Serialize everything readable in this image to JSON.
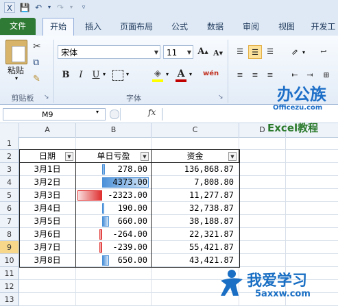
{
  "quick_access": {
    "icons": [
      "save-icon",
      "undo-icon",
      "redo-icon",
      "customize-icon"
    ]
  },
  "tabs": [
    {
      "label": "文件",
      "active": false
    },
    {
      "label": "开始",
      "active": true
    },
    {
      "label": "插入",
      "active": false
    },
    {
      "label": "页面布局",
      "active": false
    },
    {
      "label": "公式",
      "active": false
    },
    {
      "label": "数据",
      "active": false
    },
    {
      "label": "审阅",
      "active": false
    },
    {
      "label": "视图",
      "active": false
    },
    {
      "label": "开发工",
      "active": false
    }
  ],
  "ribbon": {
    "clipboard": {
      "paste_label": "粘贴",
      "group_label": "剪贴板"
    },
    "font": {
      "font_name": "宋体",
      "font_size": "11",
      "group_label": "字体",
      "bold": "B",
      "italic": "I",
      "underline": "U",
      "grow": "A",
      "shrink": "A",
      "fill_color": "#ffff00",
      "font_color": "#c00000",
      "phonetic": "wén"
    }
  },
  "formula_bar": {
    "name_box": "M9",
    "fx": "fx",
    "value": ""
  },
  "columns": [
    "A",
    "B",
    "C",
    "D"
  ],
  "rows": [
    "1",
    "2",
    "3",
    "4",
    "5",
    "6",
    "7",
    "8",
    "9",
    "10",
    "11",
    "12",
    "13"
  ],
  "selected_row": "9",
  "table": {
    "headers": [
      "日期",
      "单日亏盈",
      "资金"
    ],
    "rows": [
      {
        "date": "3月1日",
        "pl": "278.00",
        "fund": "136,868.87",
        "value": 278
      },
      {
        "date": "3月2日",
        "pl": "4373.00",
        "fund": "7,808.80",
        "value": 4373
      },
      {
        "date": "3月3日",
        "pl": "-2323.00",
        "fund": "11,277.87",
        "value": -2323
      },
      {
        "date": "3月4日",
        "pl": "190.00",
        "fund": "32,738.87",
        "value": 190
      },
      {
        "date": "3月5日",
        "pl": "660.00",
        "fund": "38,188.87",
        "value": 660
      },
      {
        "date": "3月6日",
        "pl": "-264.00",
        "fund": "22,321.87",
        "value": -264
      },
      {
        "date": "3月7日",
        "pl": "-239.00",
        "fund": "55,421.87",
        "value": -239
      },
      {
        "date": "3月8日",
        "pl": "650.00",
        "fund": "43,421.87",
        "value": 650
      }
    ],
    "bar_colors": {
      "positive": "#4a90d9",
      "negative": "#e03030"
    }
  },
  "watermarks": {
    "logo1": "办公族",
    "logo1_sub": "Officezu.com",
    "logo2": "Excel教程",
    "logo3": "我爱学习",
    "logo3_sub": "5axxw.com"
  }
}
